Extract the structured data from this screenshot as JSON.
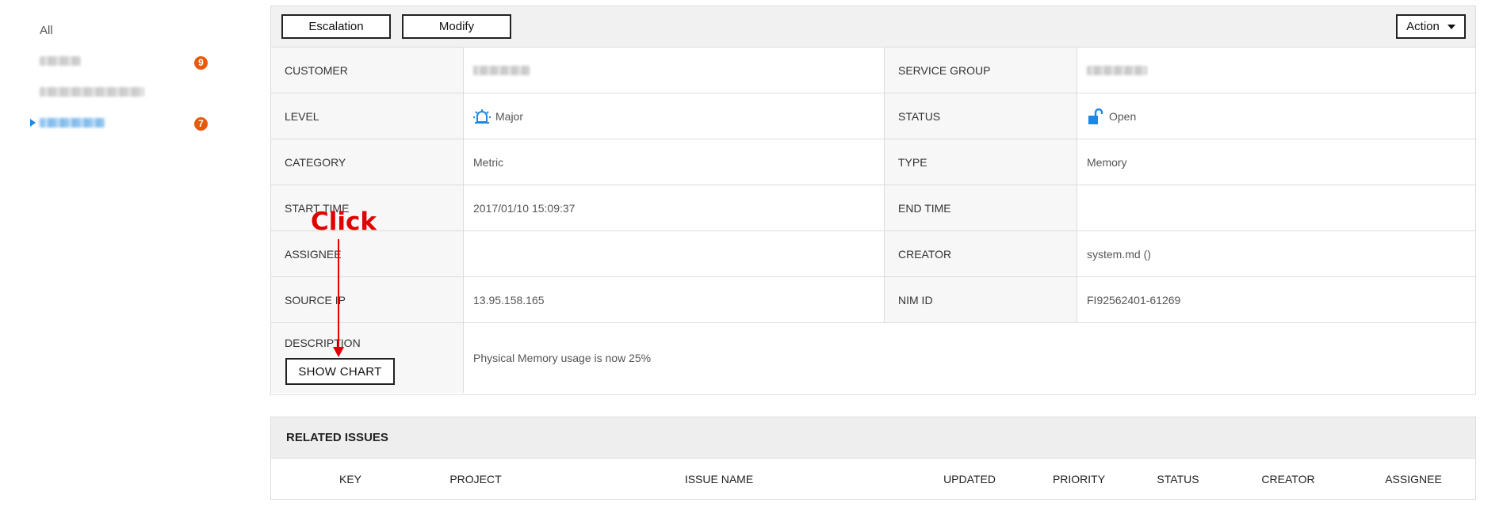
{
  "sidebar": {
    "all_label": "All",
    "items": [
      {
        "name": "sidebar-item-group-1",
        "badge": "9",
        "selected": false
      },
      {
        "name": "sidebar-item-group-2",
        "badge": null,
        "selected": false
      },
      {
        "name": "sidebar-item-group-3",
        "badge": "7",
        "selected": true
      }
    ],
    "badge_color": "#e8590c",
    "selected_color": "#1e88e5"
  },
  "toolbar": {
    "escalation_label": "Escalation",
    "modify_label": "Modify",
    "action_label": "Action"
  },
  "details": {
    "customer_label": "CUSTOMER",
    "service_group_label": "SERVICE GROUP",
    "level_label": "LEVEL",
    "level_value": "Major",
    "level_icon": "alarm-light-icon",
    "status_label": "STATUS",
    "status_value": "Open",
    "status_icon": "unlock-icon",
    "category_label": "CATEGORY",
    "category_value": "Metric",
    "type_label": "TYPE",
    "type_value": "Memory",
    "start_time_label": "START TIME",
    "start_time_value": "2017/01/10 15:09:37",
    "end_time_label": "END TIME",
    "end_time_value": "",
    "assignee_label": "ASSIGNEE",
    "assignee_value": "",
    "creator_label": "CREATOR",
    "creator_value": "system.md ()",
    "source_ip_label": "SOURCE IP",
    "source_ip_value": "13.95.158.165",
    "nim_id_label": "NIM ID",
    "nim_id_value": "FI92562401-61269",
    "description_label": "DESCRIPTION",
    "description_value": "Physical Memory usage is now 25%",
    "show_chart_label": "SHOW CHART"
  },
  "annotation": {
    "text": "Click",
    "color": "#e00000"
  },
  "related": {
    "title": "RELATED ISSUES",
    "columns": [
      "KEY",
      "PROJECT",
      "ISSUE NAME",
      "UPDATED",
      "PRIORITY",
      "STATUS",
      "CREATOR",
      "ASSIGNEE"
    ]
  }
}
